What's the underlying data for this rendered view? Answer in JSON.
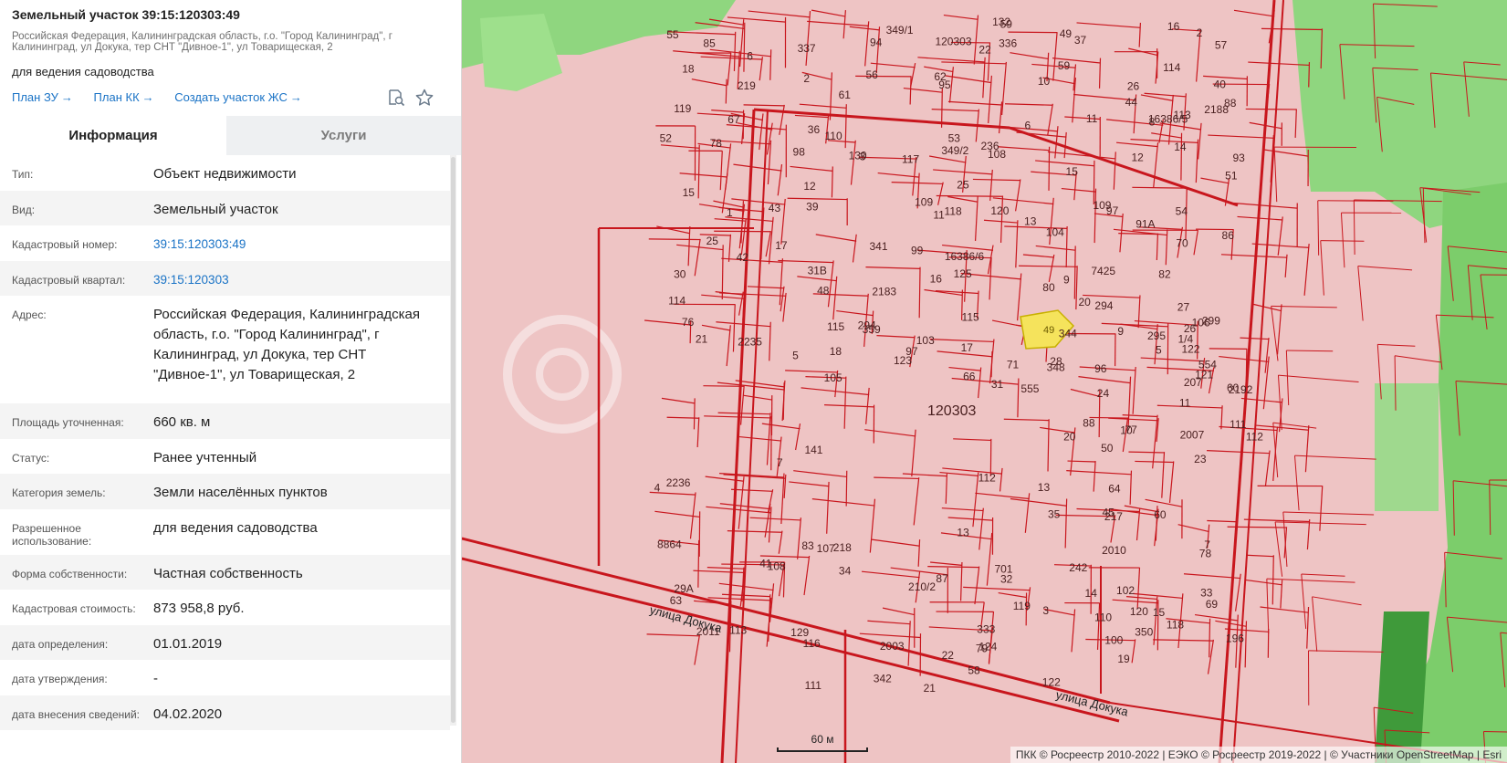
{
  "header": {
    "title": "Земельный участок 39:15:120303:49",
    "address": "Российская Федерация, Калининградская область, г.о. \"Город Калининград\", г Калининград, ул Докука, тер СНТ \"Дивное-1\", ул Товарищеская, 2",
    "use": "для ведения садоводства",
    "links": [
      "План ЗУ",
      "План КК",
      "Создать участок ЖС"
    ],
    "arrow": "→",
    "icons": [
      "search-document-icon",
      "star-icon"
    ]
  },
  "tabs": {
    "info": "Информация",
    "services": "Услуги"
  },
  "properties": [
    {
      "key": "Тип:",
      "value": "Объект недвижимости"
    },
    {
      "key": "Вид:",
      "value": "Земельный участок"
    },
    {
      "key": "Кадастровый номер:",
      "value": "39:15:120303:49",
      "link": true
    },
    {
      "key": "Кадастровый квартал:",
      "value": "39:15:120303",
      "link": true
    },
    {
      "key": "Адрес:",
      "value": "Российская Федерация, Калининградская область, г.о. \"Город Калининград\", г Калининград, ул Докука, тер СНТ \"Дивное-1\", ул Товарищеская, 2"
    },
    {
      "key": "Площадь уточненная:",
      "value": "660 кв. м"
    },
    {
      "key": "Статус:",
      "value": "Ранее учтенный"
    },
    {
      "key": "Категория земель:",
      "value": "Земли населённых пунктов"
    },
    {
      "key": "Разрешенное использование:",
      "value": "для ведения садоводства"
    },
    {
      "key": "Форма собственности:",
      "value": "Частная собственность"
    },
    {
      "key": "Кадастровая стоимость:",
      "value": "873 958,8 руб."
    },
    {
      "key": "дата определения:",
      "value": "01.01.2019"
    },
    {
      "key": "дата утверждения:",
      "value": "-"
    },
    {
      "key": "дата внесения сведений:",
      "value": "04.02.2020"
    }
  ],
  "map": {
    "selected_parcel": "49",
    "quarter_label": "120303",
    "street_label": "улица Докука",
    "street_label_2": "улица Докука",
    "scale_label": "60 м",
    "attribution": "ПКК © Росреестр 2010-2022 | ЕЭКО © Росреестр 2019-2022 | © Участники OpenStreetMap | Esri",
    "colors": {
      "parcel_fill": "#eec4c4",
      "parcel_line": "#c8161d",
      "green_zone": "#8fd67f",
      "selected_fill": "#f5e35c"
    },
    "parcel_numbers": [
      "15",
      "12",
      "9",
      "22",
      "8",
      "21",
      "20",
      "18",
      "113",
      "112",
      "111",
      "110",
      "109",
      "108",
      "114",
      "116",
      "115",
      "117",
      "118",
      "119",
      "120",
      "121",
      "16",
      "13",
      "11",
      "17",
      "14",
      "10",
      "6",
      "5",
      "4",
      "3",
      "2",
      "1",
      "119",
      "2",
      "3",
      "6",
      "336",
      "8864",
      "97",
      "98",
      "99",
      "102",
      "333",
      "51",
      "52",
      "5",
      "7",
      "10",
      "11",
      "104",
      "103",
      "50",
      "53",
      "61",
      "63",
      "64",
      "14",
      "13",
      "12",
      "55",
      "54",
      "57",
      "58",
      "67",
      "66",
      "59",
      "15",
      "16",
      "17",
      "33",
      "34",
      "35",
      "42",
      "43",
      "56",
      "59",
      "60",
      "69",
      "70",
      "71",
      "20",
      "21",
      "19",
      "18",
      "32",
      "7425",
      "36",
      "45",
      "44",
      "49",
      "554",
      "105",
      "122",
      "123",
      "124",
      "125",
      "22",
      "23",
      "31",
      "344",
      "37",
      "41",
      "219",
      "48",
      "28",
      "39",
      "40",
      "342",
      "341",
      "76",
      "555",
      "77",
      "78",
      "24",
      "27",
      "26",
      "25",
      "88",
      "218",
      "93",
      "94",
      "95",
      "96",
      "97",
      "217",
      "88",
      "87",
      "120303",
      "83",
      "82",
      "86",
      "80",
      "1/4",
      "79",
      "107",
      "106",
      "108",
      "109",
      "141",
      "359",
      "349/2",
      "31В",
      "337",
      "110",
      "111",
      "120",
      "112",
      "701",
      "348",
      "129",
      "236",
      "114",
      "113",
      "115",
      "118",
      "132",
      "350",
      "122",
      "207",
      "100",
      "349/1",
      "210/2",
      "242",
      "130",
      "25",
      "196",
      "30",
      "62",
      "11",
      "15",
      "13",
      "26",
      "85",
      "2183",
      "29А",
      "78",
      "2192",
      "2188",
      "7",
      "9",
      "91А",
      "2010",
      "2235",
      "2236",
      "2011",
      "2003",
      "2007",
      "16386/6",
      "16386/5",
      "294",
      "294",
      "295",
      "299",
      "60"
    ]
  }
}
